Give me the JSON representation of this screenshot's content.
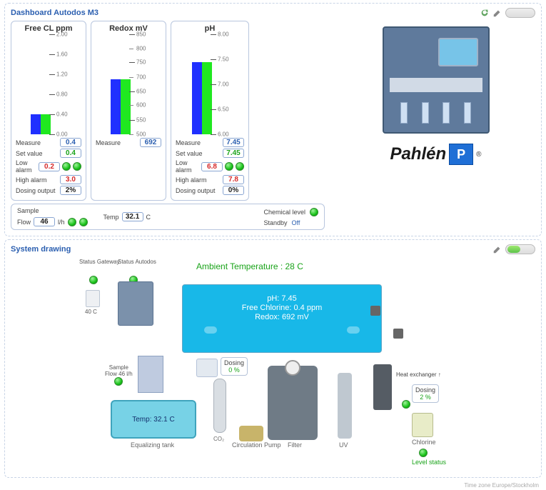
{
  "dashboard": {
    "title": "Dashboard Autodos M3",
    "gauges": {
      "freecl": {
        "title": "Free CL ppm",
        "scale_max": 2.0,
        "ticks": [
          "2.00",
          "1.60",
          "1.20",
          "0.80",
          "0.40",
          "0.00"
        ],
        "measure_label": "Measure",
        "measure": "0.4",
        "setvalue_label": "Set value",
        "setvalue": "0.4",
        "lowalarm_label": "Low alarm",
        "lowalarm": "0.2",
        "highalarm_label": "High alarm",
        "highalarm": "3.0",
        "dosing_label": "Dosing output",
        "dosing": "2%"
      },
      "redox": {
        "title": "Redox mV",
        "scale_max": 850,
        "scale_min": 500,
        "ticks": [
          "850",
          "800",
          "750",
          "700",
          "650",
          "600",
          "550",
          "500"
        ],
        "measure_label": "Measure",
        "measure": "692"
      },
      "ph": {
        "title": "pH",
        "scale_max": 8.0,
        "scale_min": 6.0,
        "ticks": [
          "8.00",
          "7.50",
          "7.00",
          "6.50",
          "6.00"
        ],
        "measure_label": "Measure",
        "measure": "7.45",
        "setvalue_label": "Set value",
        "setvalue": "7.45",
        "lowalarm_label": "Low alarm",
        "lowalarm": "6.8",
        "highalarm_label": "High alarm",
        "highalarm": "7.8",
        "dosing_label": "Dosing output",
        "dosing": "0%"
      }
    },
    "sample": {
      "label": "Sample",
      "flow_label": "Flow",
      "flow_value": "46",
      "flow_unit": "l/h",
      "temp_label": "Temp",
      "temp_value": "32.1",
      "temp_unit": "C",
      "chemical_label": "Chemical level",
      "standby_label": "Standby",
      "standby_value": "Off"
    },
    "brand": "Pahlén"
  },
  "system": {
    "title": "System drawing",
    "ambient_label": "Ambient Temperature : 28 C",
    "status_gateway_label": "Status Gateway",
    "status_autodos_label": "Status Autodos",
    "gateway_temp": "40 C",
    "pool": {
      "ph": "pH: 7.45",
      "cl": "Free Chlorine: 0.4 ppm",
      "redox": "Redox: 692 mV"
    },
    "sample_label": "Sample",
    "sample_flow": "Flow 46 l/h",
    "tank_temp": "Temp: 32.1 C",
    "dosing_left_label": "Dosing",
    "dosing_left_value": "0 %",
    "dosing_right_label": "Dosing",
    "dosing_right_value": "2 %",
    "hx_label": "Heat exchanger",
    "chlorine_label": "Chlorine",
    "level_label": "Level status",
    "labels": {
      "eq_tank": "Equalizing tank",
      "circ_pump": "Circulation Pump",
      "filter": "Filter",
      "uv": "UV",
      "co2": "CO₂"
    }
  },
  "footer": "Time zone Europe/Stockholm"
}
